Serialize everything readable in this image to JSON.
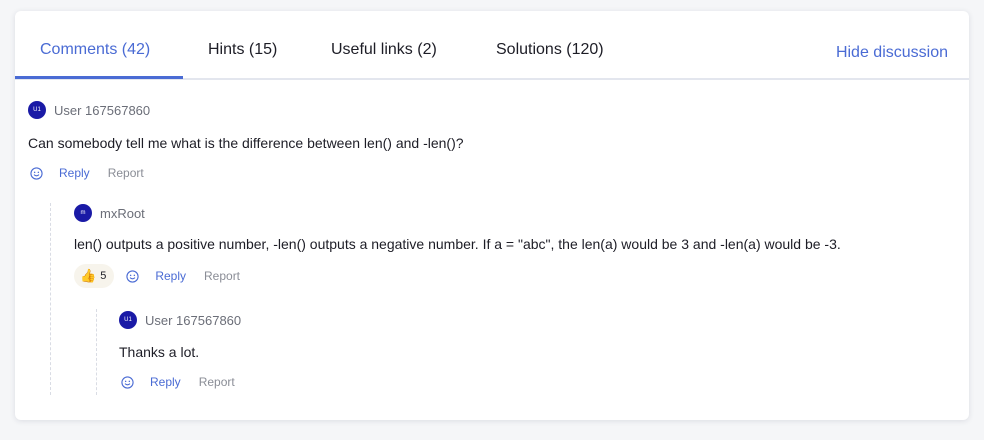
{
  "tabs": [
    {
      "label": "Comments (42)"
    },
    {
      "label": "Hints (15)"
    },
    {
      "label": "Useful links (2)"
    },
    {
      "label": "Solutions (120)"
    }
  ],
  "hide_discussion": "Hide discussion",
  "comments": [
    {
      "avatar": "U1",
      "author": "User 167567860",
      "text": "Can somebody tell me what is the difference between len() and -len()?",
      "reply": "Reply",
      "report": "Report"
    },
    {
      "avatar": "m",
      "author": "mxRoot",
      "text": "len() outputs a positive number, -len() outputs a negative number. If a = \"abc\", the len(a) would be 3 and -len(a) would be -3.",
      "reaction_count": "5",
      "reply": "Reply",
      "report": "Report"
    },
    {
      "avatar": "U1",
      "author": "User 167567860",
      "text": "Thanks a lot.",
      "reply": "Reply",
      "report": "Report"
    }
  ],
  "colors": {
    "accent": "#4a6bd4",
    "avatar": "#1a1aa6"
  }
}
